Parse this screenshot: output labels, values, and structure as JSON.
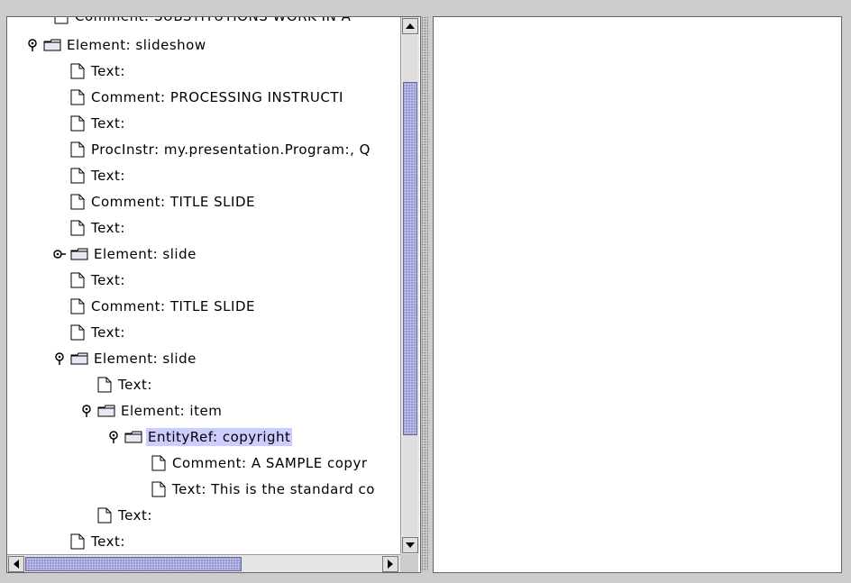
{
  "tree": {
    "top_partial_label": "Comment: SUBSTITUTIONS WORK IN A",
    "rows": [
      {
        "label": "Element: slideshow",
        "icon": "folder",
        "handle": "expanded",
        "level": 0
      },
      {
        "label": "Text:",
        "icon": "document",
        "level": 1
      },
      {
        "label": "Comment: PROCESSING INSTRUCTI",
        "icon": "document",
        "level": 1
      },
      {
        "label": "Text:",
        "icon": "document",
        "level": 1
      },
      {
        "label": "ProcInstr: my.presentation.Program:, Q",
        "icon": "document",
        "level": 1
      },
      {
        "label": "Text:",
        "icon": "document",
        "level": 1
      },
      {
        "label": "Comment: TITLE SLIDE",
        "icon": "document",
        "level": 1
      },
      {
        "label": "Text:",
        "icon": "document",
        "level": 1
      },
      {
        "label": "Element: slide",
        "icon": "folder",
        "handle": "collapsed",
        "level": 1
      },
      {
        "label": "Text:",
        "icon": "document",
        "level": 1
      },
      {
        "label": "Comment: TITLE SLIDE",
        "icon": "document",
        "level": 1
      },
      {
        "label": "Text:",
        "icon": "document",
        "level": 1
      },
      {
        "label": "Element: slide",
        "icon": "folder",
        "handle": "expanded",
        "level": 1
      },
      {
        "label": "Text:",
        "icon": "document",
        "level": 2
      },
      {
        "label": "Element: item",
        "icon": "folder",
        "handle": "expanded",
        "level": 2
      },
      {
        "label": "EntityRef: copyright",
        "icon": "folder",
        "handle": "expanded",
        "level": 3,
        "selected": true
      },
      {
        "label": "Comment: A SAMPLE copyr",
        "icon": "document",
        "level": 4
      },
      {
        "label": "Text: This is the standard co",
        "icon": "document",
        "level": 4
      },
      {
        "label": "Text:",
        "icon": "document",
        "level": 2
      },
      {
        "label": "Text:",
        "icon": "document",
        "level": 1
      }
    ]
  },
  "colors": {
    "selection": "#ccccff",
    "scroll_thumb": "#9999cc",
    "background": "#cccccc"
  },
  "scroll": {
    "vertical_thumb_fraction": 0.7,
    "horizontal_thumb_fraction": 0.55
  }
}
